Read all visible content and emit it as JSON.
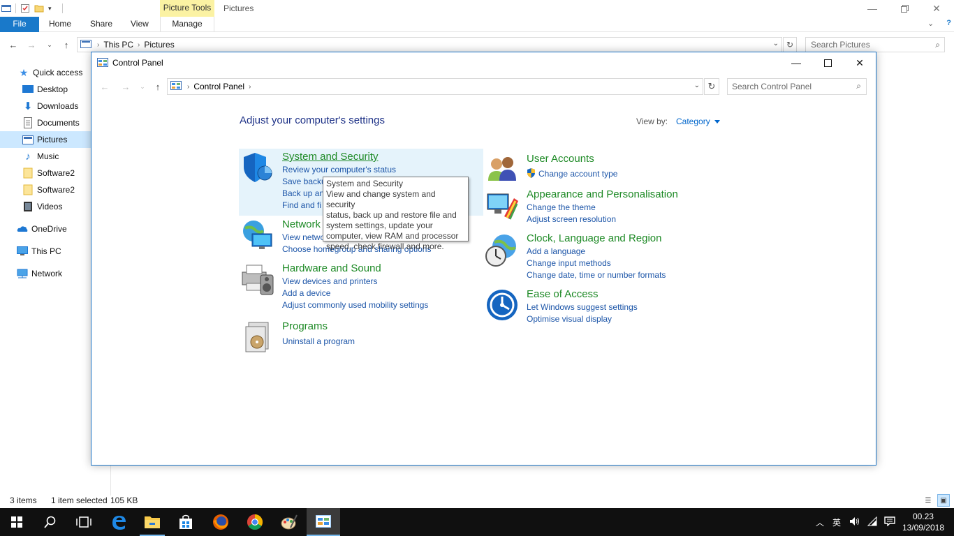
{
  "explorer": {
    "window_title": "Pictures",
    "contextual_tab_group": "Picture Tools",
    "ribbon_tabs": [
      "File",
      "Home",
      "Share",
      "View",
      "Manage"
    ],
    "address": [
      "This PC",
      "Pictures"
    ],
    "search_placeholder": "Search Pictures",
    "nav_items": [
      {
        "label": "Quick access",
        "icon": "star-icon"
      },
      {
        "label": "Desktop",
        "icon": "desktop-icon"
      },
      {
        "label": "Downloads",
        "icon": "download-icon"
      },
      {
        "label": "Documents",
        "icon": "document-icon"
      },
      {
        "label": "Pictures",
        "icon": "pictures-icon"
      },
      {
        "label": "Music",
        "icon": "music-icon"
      },
      {
        "label": "Software2",
        "icon": "folder-icon"
      },
      {
        "label": "Software2",
        "icon": "folder-icon"
      },
      {
        "label": "Videos",
        "icon": "video-icon"
      },
      {
        "label": "OneDrive",
        "icon": "cloud-icon"
      },
      {
        "label": "This PC",
        "icon": "computer-icon"
      },
      {
        "label": "Network",
        "icon": "network-icon"
      }
    ],
    "status": {
      "items": "3 items",
      "selected": "1 item selected",
      "size": "105 KB"
    }
  },
  "control_panel": {
    "window_title": "Control Panel",
    "address": [
      "Control Panel"
    ],
    "search_placeholder": "Search Control Panel",
    "heading": "Adjust your computer's settings",
    "view_by_label": "View by:",
    "view_by_value": "Category",
    "categories_left": [
      {
        "title": "System and Security",
        "links": [
          "Review your computer's status",
          "Save backu",
          "Back up an",
          "Find and fi"
        ]
      },
      {
        "title": "Network",
        "links": [
          "View netwo",
          "Choose homegroup and sharing options"
        ]
      },
      {
        "title": "Hardware and Sound",
        "links": [
          "View devices and printers",
          "Add a device",
          "Adjust commonly used mobility settings"
        ]
      },
      {
        "title": "Programs",
        "links": [
          "Uninstall a program"
        ]
      }
    ],
    "categories_right": [
      {
        "title": "User Accounts",
        "links": [
          "Change account type"
        ]
      },
      {
        "title": "Appearance and Personalisation",
        "links": [
          "Change the theme",
          "Adjust screen resolution"
        ]
      },
      {
        "title": "Clock, Language and Region",
        "links": [
          "Add a language",
          "Change input methods",
          "Change date, time or number formats"
        ]
      },
      {
        "title": "Ease of Access",
        "links": [
          "Let Windows suggest settings",
          "Optimise visual display"
        ]
      }
    ],
    "tooltip": {
      "title": "System and Security",
      "lines": [
        "View and change system and security",
        "status, back up and restore file and",
        "system settings, update your",
        "computer, view RAM and processor",
        "speed, check firewall and more."
      ]
    }
  },
  "taskbar": {
    "clock_time": "00.23",
    "clock_date": "13/09/2018",
    "ime_label": "英"
  },
  "colors": {
    "accent": "#1979ca",
    "category_title": "#1e8a26",
    "link": "#1c55a8",
    "heading": "#1e3287",
    "taskbar": "#101010"
  }
}
